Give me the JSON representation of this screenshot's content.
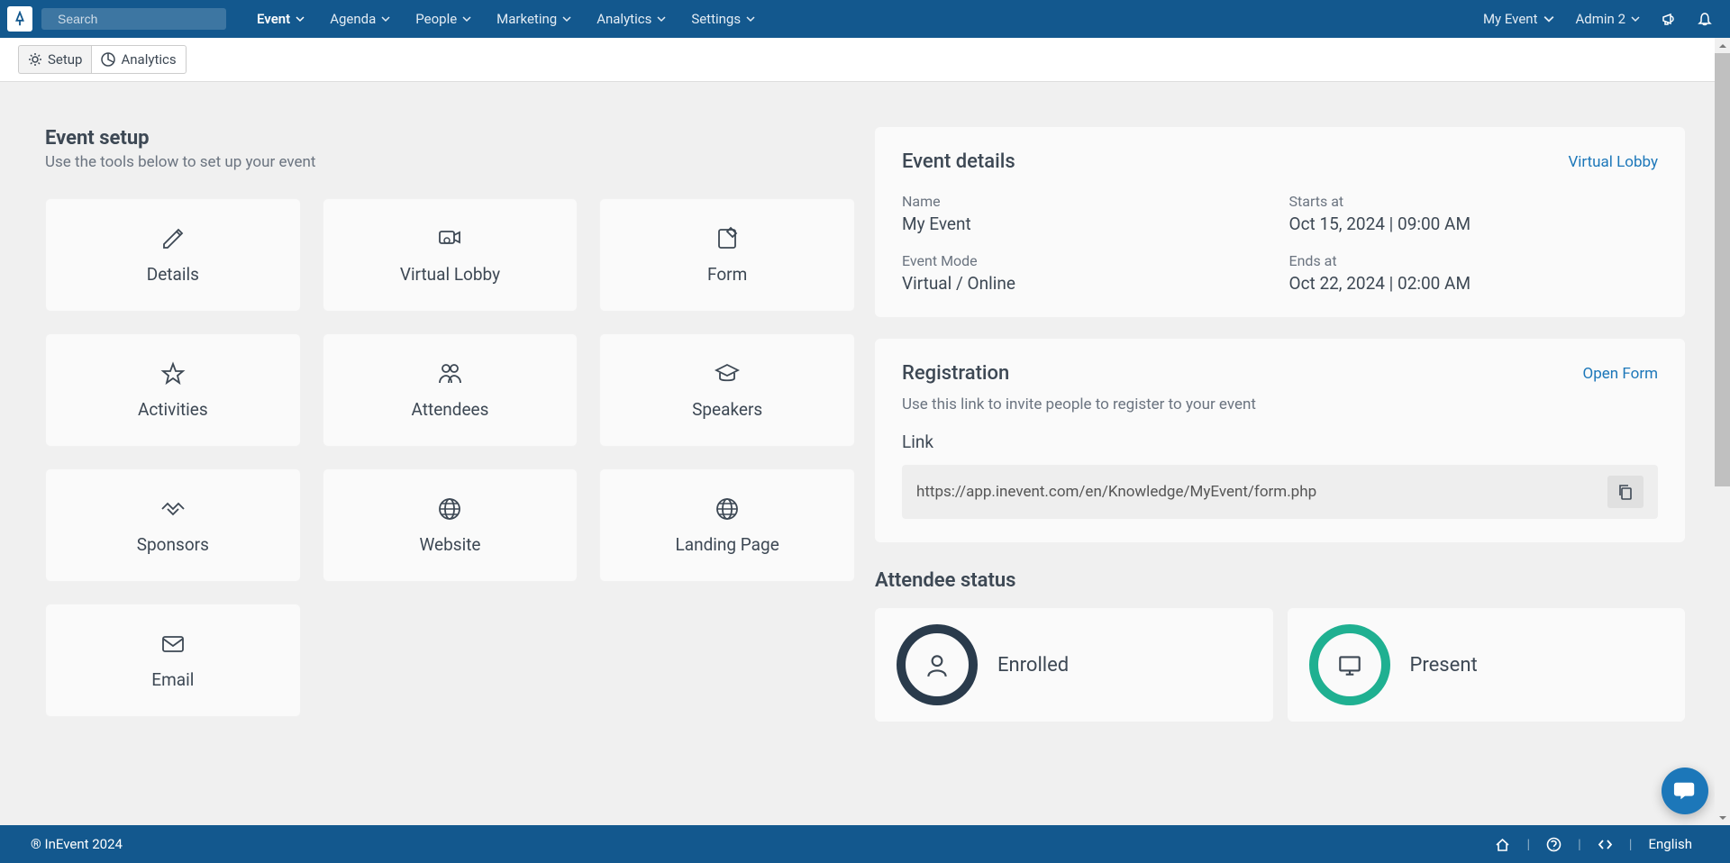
{
  "topbar": {
    "search_placeholder": "Search",
    "nav": [
      {
        "label": "Event",
        "active": true
      },
      {
        "label": "Agenda",
        "active": false
      },
      {
        "label": "People",
        "active": false
      },
      {
        "label": "Marketing",
        "active": false
      },
      {
        "label": "Analytics",
        "active": false
      },
      {
        "label": "Settings",
        "active": false
      }
    ],
    "event_switcher": "My Event",
    "user": "Admin 2"
  },
  "subtabs": {
    "setup": "Setup",
    "analytics": "Analytics"
  },
  "page": {
    "title": "Event setup",
    "subtitle": "Use the tools below to set up your event"
  },
  "cards": [
    {
      "key": "details",
      "label": "Details",
      "icon": "pencil"
    },
    {
      "key": "virtual-lobby",
      "label": "Virtual Lobby",
      "icon": "video-gear"
    },
    {
      "key": "form",
      "label": "Form",
      "icon": "form"
    },
    {
      "key": "activities",
      "label": "Activities",
      "icon": "star"
    },
    {
      "key": "attendees",
      "label": "Attendees",
      "icon": "people"
    },
    {
      "key": "speakers",
      "label": "Speakers",
      "icon": "cap"
    },
    {
      "key": "sponsors",
      "label": "Sponsors",
      "icon": "handshake"
    },
    {
      "key": "website",
      "label": "Website",
      "icon": "globe"
    },
    {
      "key": "landing-page",
      "label": "Landing Page",
      "icon": "globe"
    },
    {
      "key": "email",
      "label": "Email",
      "icon": "mail"
    }
  ],
  "event_details": {
    "title": "Event details",
    "link_label": "Virtual Lobby",
    "name_label": "Name",
    "name_value": "My Event",
    "starts_label": "Starts at",
    "starts_value": "Oct 15, 2024 | 09:00 AM",
    "mode_label": "Event Mode",
    "mode_value": "Virtual / Online",
    "ends_label": "Ends at",
    "ends_value": "Oct 22, 2024 | 02:00 AM"
  },
  "registration": {
    "title": "Registration",
    "link_label": "Open Form",
    "subtitle": "Use this link to invite people to register to your event",
    "field_label": "Link",
    "url": "https://app.inevent.com/en/Knowledge/MyEvent/form.php"
  },
  "attendee_status": {
    "title": "Attendee status",
    "enrolled": "Enrolled",
    "present": "Present"
  },
  "footer": {
    "copyright": "® InEvent 2024",
    "language": "English"
  }
}
